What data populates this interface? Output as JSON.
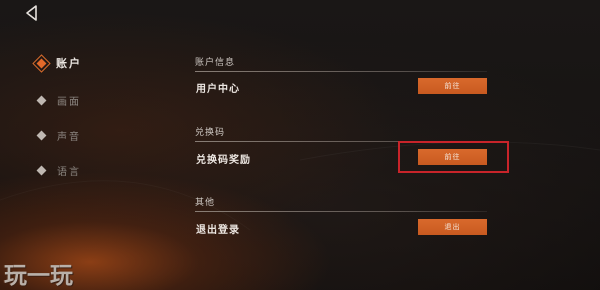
{
  "nav": {
    "items": [
      {
        "label": "账户",
        "active": true
      },
      {
        "label": "画面",
        "active": false
      },
      {
        "label": "声音",
        "active": false
      },
      {
        "label": "语言",
        "active": false
      }
    ]
  },
  "sections": [
    {
      "title": "账户信息",
      "row_label": "用户中心",
      "button_label": "前往"
    },
    {
      "title": "兑换码",
      "row_label": "兑换码奖励",
      "button_label": "前往"
    },
    {
      "title": "其他",
      "row_label": "退出登录",
      "button_label": "退出"
    }
  ],
  "watermark": "玩一玩",
  "colors": {
    "accent": "#d9692c",
    "highlight_box": "#c8242a",
    "background": "#141212"
  },
  "icons": {
    "back": "back-arrow-icon",
    "nav_bullet": "diamond-icon"
  }
}
